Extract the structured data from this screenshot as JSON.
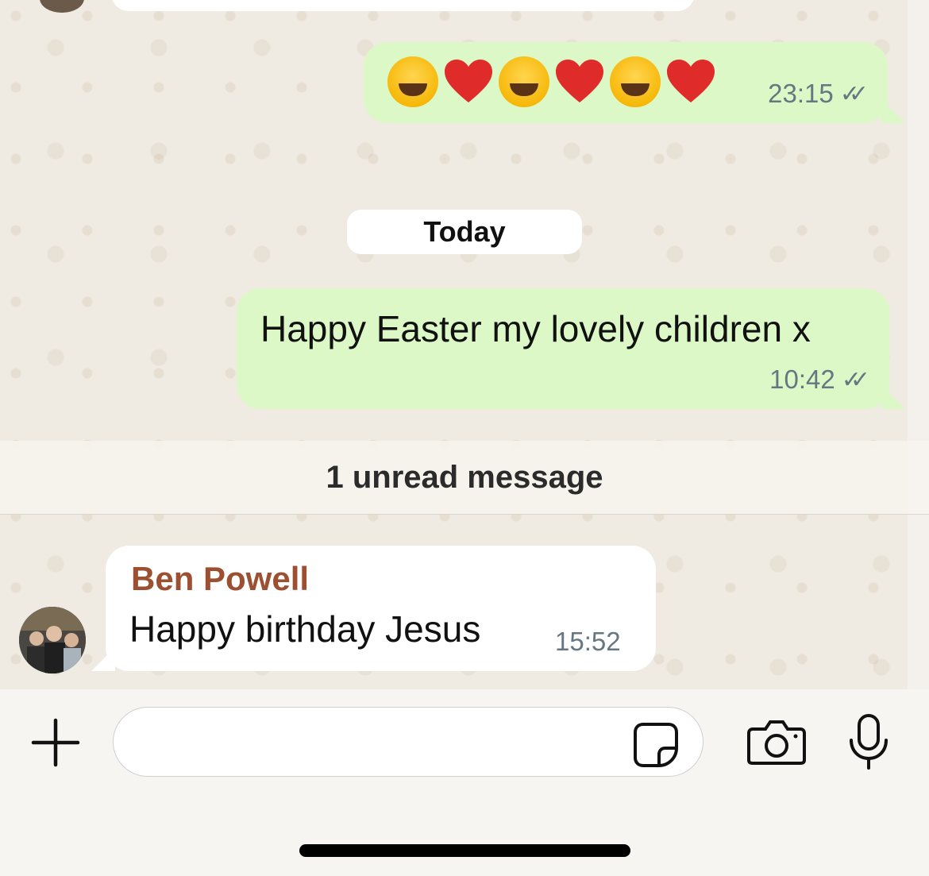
{
  "messages": {
    "emoji_message": {
      "emojis": [
        "face-with-tears-of-joy",
        "red-heart",
        "face-with-tears-of-joy",
        "red-heart",
        "face-with-tears-of-joy",
        "red-heart"
      ],
      "time": "23:15",
      "status": "read"
    },
    "date_separator": "Today",
    "outgoing": {
      "text": "Happy Easter my lovely children x",
      "time": "10:42",
      "status": "read"
    },
    "unread_banner": "1 unread message",
    "incoming": {
      "sender": "Ben Powell",
      "text": "Happy birthday Jesus",
      "time": "15:52"
    }
  },
  "composer": {
    "input_value": "",
    "input_placeholder": "",
    "icons": [
      "plus-icon",
      "sticker-icon",
      "camera-icon",
      "microphone-icon"
    ]
  },
  "colors": {
    "outgoing_bubble": "#dcf8c6",
    "incoming_bubble": "#ffffff",
    "sender_name": "#9c4f31",
    "chat_background": "#efeae2",
    "meta_text": "#667781"
  }
}
